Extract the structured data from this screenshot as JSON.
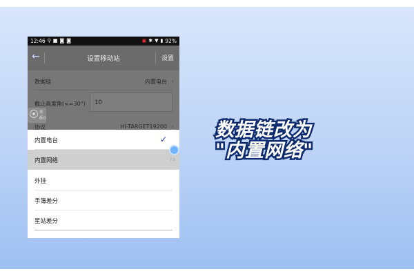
{
  "statusbar": {
    "time": "12:46",
    "left_icons": [
      "location-icon",
      "square-icon",
      "notification-icon",
      "notification-icon"
    ],
    "right_icons": [
      "sim-icon",
      "bluetooth-icon",
      "wifi-icon"
    ],
    "battery": "92%"
  },
  "appbar": {
    "back_glyph": "←",
    "title": "设置移动站",
    "action": "设置"
  },
  "form": {
    "datalink_label": "数据链",
    "datalink_value": "内置电台",
    "elevation_label": "截止高度角(<=30°)",
    "elevation_value": "10",
    "protocol_label": "协议",
    "protocol_value": "HI-TARGET19200"
  },
  "floating_widget": {
    "label": "单点",
    "value": "0.0"
  },
  "sheet": {
    "options": [
      "内置电台",
      "内置网络",
      "外挂",
      "手簿差分",
      "星站差分"
    ],
    "selected": "内置电台",
    "highlighted": "内置网络"
  },
  "scroll_tag": "7,0",
  "caption": {
    "line1": "数据链改为",
    "line2": "\"内置网络\""
  }
}
